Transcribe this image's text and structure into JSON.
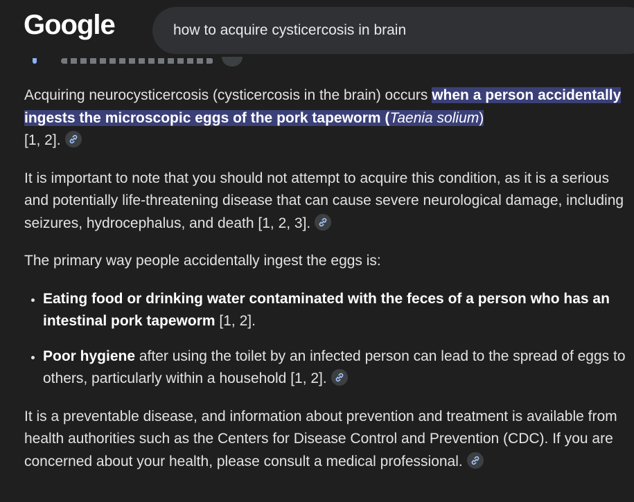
{
  "header": {
    "logo_text": "Google",
    "search_value": "how to acquire cysticercosis in brain"
  },
  "answer": {
    "p1": {
      "lead": "Acquiring neurocysticercosis (cysticercosis in the brain) occurs ",
      "highlight_a": "when a person accidentally ingests the microscopic eggs of the pork tapeworm (",
      "highlight_italic": "Taenia solium",
      "highlight_b": ")",
      "citation": " [1, 2]."
    },
    "p2": {
      "text": "It is important to note that you should not attempt to acquire this condition, as it is a serious and potentially life-threatening disease that can cause severe neurological damage, including seizures, hydrocephalus, and death [1, 2, 3]."
    },
    "p3": {
      "text": "The primary way people accidentally ingest the eggs is:"
    },
    "bullets": [
      {
        "bold": "Eating food or drinking water contaminated with the feces of a person who has an intestinal pork tapeworm",
        "rest": " [1, 2]."
      },
      {
        "bold": "Poor hygiene",
        "rest": " after using the toilet by an infected person can lead to the spread of eggs to others, particularly within a household [1, 2]."
      }
    ],
    "p4": {
      "text": "It is a preventable disease, and information about prevention and treatment is available from health authorities such as the Centers for Disease Control and Prevention (CDC). If you are concerned about your health, please consult a medical professional."
    }
  },
  "icons": {
    "link_chip": "link-icon"
  },
  "colors": {
    "background": "#1f1f1f",
    "search_bg": "#303134",
    "highlight_bg": "#3b4078",
    "chip_bg": "#3c4043",
    "link_icon": "#a8c7fa"
  }
}
